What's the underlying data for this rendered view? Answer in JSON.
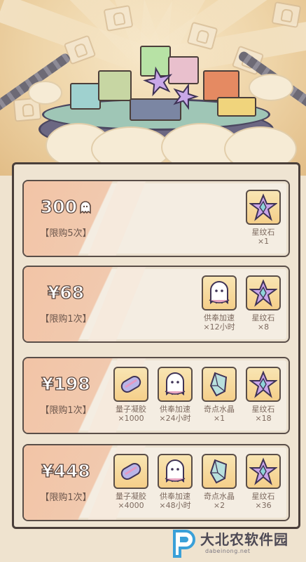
{
  "scene": {
    "decor": "treasure-platform-with-gifts"
  },
  "offers": [
    {
      "price": "300",
      "currency_icon": "ghost-coin-icon",
      "limit": "【限购5次】",
      "items": [
        {
          "icon": "star-crystal-icon",
          "name": "星纹石",
          "qty": "×1"
        }
      ]
    },
    {
      "price": "¥68",
      "limit": "【限购1次】",
      "items": [
        {
          "icon": "ghost-icon",
          "name": "供奉加速",
          "qty": "×12小时"
        },
        {
          "icon": "star-crystal-icon",
          "name": "星纹石",
          "qty": "×8"
        }
      ]
    },
    {
      "price": "¥198",
      "limit": "【限购1次】",
      "items": [
        {
          "icon": "quantum-gel-icon",
          "name": "量子凝胶",
          "qty": "×1000"
        },
        {
          "icon": "ghost-icon",
          "name": "供奉加速",
          "qty": "×24小时"
        },
        {
          "icon": "crystal-icon",
          "name": "奇点水晶",
          "qty": "×1"
        },
        {
          "icon": "star-crystal-icon",
          "name": "星纹石",
          "qty": "×18"
        }
      ]
    },
    {
      "price": "¥448",
      "limit": "【限购1次】",
      "items": [
        {
          "icon": "quantum-gel-icon",
          "name": "量子凝胶",
          "qty": "×4000"
        },
        {
          "icon": "ghost-icon",
          "name": "供奉加速",
          "qty": "×48小时"
        },
        {
          "icon": "crystal-icon",
          "name": "奇点水晶",
          "qty": "×2"
        },
        {
          "icon": "star-crystal-icon",
          "name": "星纹石",
          "qty": "×36"
        }
      ]
    }
  ],
  "watermark": {
    "title": "大北农软件园",
    "url": "dabeinong.net"
  },
  "colors": {
    "panel": "#efe4d2",
    "tint": "#f2c4a6",
    "icon_bg": "#f5cf8a",
    "border": "#5a4e48"
  }
}
